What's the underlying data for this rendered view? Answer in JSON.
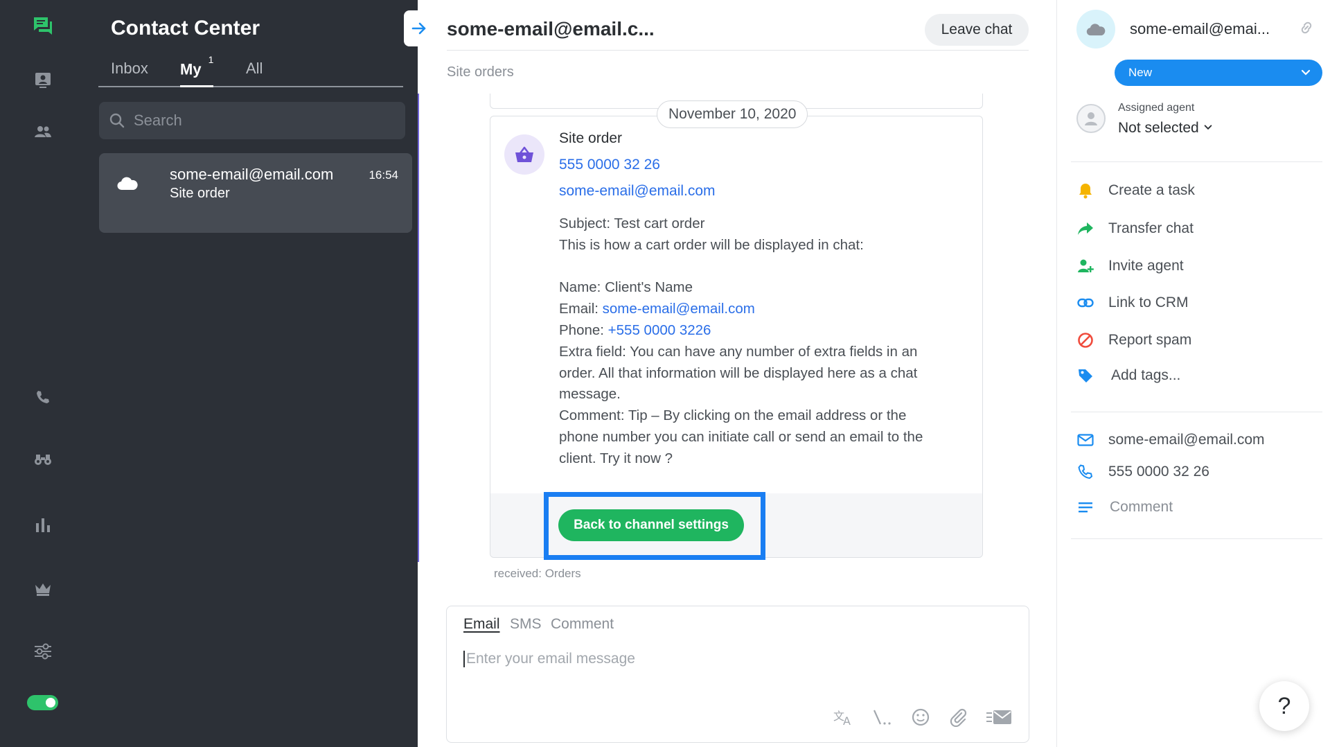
{
  "app": {
    "title": "Contact Center"
  },
  "list": {
    "tabs": [
      {
        "label": "Inbox"
      },
      {
        "label": "My",
        "count": "1"
      },
      {
        "label": "All"
      }
    ],
    "search_placeholder": "Search",
    "conversations": [
      {
        "name": "some-email@email.com",
        "subtitle": "Site order",
        "time": "16:54"
      }
    ]
  },
  "chat": {
    "title": "some-email@email.c...",
    "leave_label": "Leave chat",
    "subtitle": "Site orders",
    "date": "November 10, 2020",
    "message": {
      "title": "Site order",
      "phone": "555 0000 32 26",
      "email": "some-email@email.com",
      "subject_line": "Subject: Test cart order",
      "intro_line": "This is how a cart order will be displayed in chat:",
      "name_line": "Name: Client's Name",
      "email_prefix": "Email: ",
      "email_value": "some-email@email.com",
      "phone_prefix": "Phone: ",
      "phone_value": "+555 0000 3226",
      "extra_1": "Extra field: You can have any number of extra fields in an",
      "extra_2": "order. All that information will be displayed here as a chat",
      "extra_3": "message.",
      "comment_1": "Comment: Tip – By clicking on the email address or the",
      "comment_2": "phone number you can initiate call or send an email to the",
      "comment_3": "client. Try it now ?",
      "button_label": "Back to channel settings"
    },
    "received": "received: Orders",
    "composer": {
      "tabs": [
        {
          "label": "Email",
          "active": true
        },
        {
          "label": "SMS",
          "active": false
        },
        {
          "label": "Comment",
          "active": false
        }
      ],
      "placeholder": "Enter your email message"
    }
  },
  "contact": {
    "name": "some-email@emai...",
    "status": "New",
    "assigned_label": "Assigned agent",
    "assigned_value": "Not selected",
    "actions": [
      {
        "label": "Create a task",
        "icon": "bell-icon",
        "color": "#f5b400"
      },
      {
        "label": "Transfer chat",
        "icon": "share-arrow-icon",
        "color": "#1fb55f"
      },
      {
        "label": "Invite agent",
        "icon": "add-user-icon",
        "color": "#1fb55f"
      },
      {
        "label": "Link to CRM",
        "icon": "link-icon",
        "color": "#1a8cf0"
      },
      {
        "label": "Report spam",
        "icon": "block-icon",
        "color": "#f04b3c"
      },
      {
        "label": "Add tags...",
        "icon": "tag-icon",
        "color": "#1a8cf0"
      }
    ],
    "details": {
      "email": "some-email@email.com",
      "phone": "555 0000 32 26",
      "comment": "Comment"
    }
  },
  "help": {
    "label": "?"
  },
  "colors": {
    "sidebar_bg": "#2c3037",
    "accent_green": "#1fb55f",
    "accent_blue": "#1a8cf0",
    "highlight_border": "#1a7ef2"
  }
}
